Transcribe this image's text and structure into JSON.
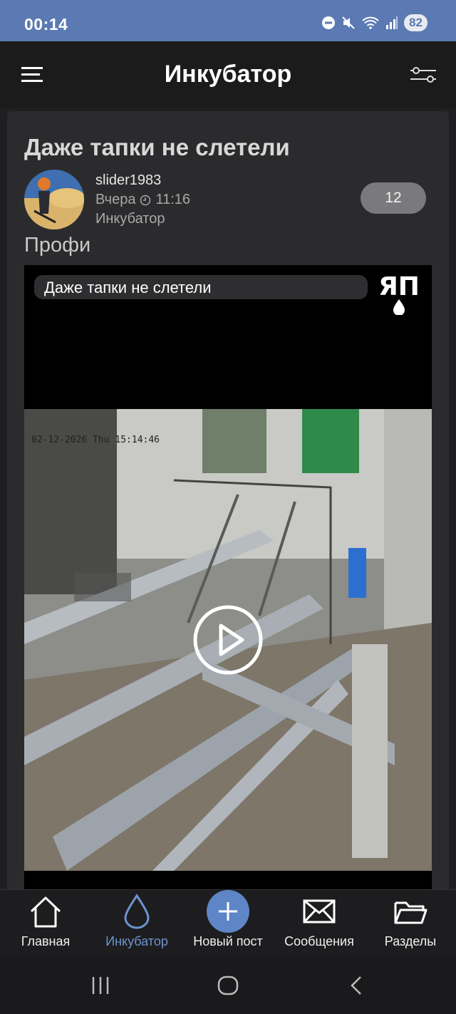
{
  "status_bar": {
    "time": "00:14",
    "battery": "82",
    "icons": [
      "dnd-icon",
      "mute-icon",
      "wifi-icon",
      "signal-icon"
    ]
  },
  "app_bar": {
    "title": "Инкубатор"
  },
  "post": {
    "title": "Даже тапки не слетели",
    "author": "slider1983",
    "date_label": "Вчера",
    "time": "11:16",
    "section": "Инкубатор",
    "comment_count": "12",
    "tag": "Профи",
    "video": {
      "caption": "Даже тапки не слетели",
      "watermark": "ЯП",
      "camera_timestamp": "02-12-2026 Thu 15:14:46"
    }
  },
  "bottom_nav": {
    "items": [
      {
        "label": "Главная",
        "icon": "home-icon"
      },
      {
        "label": "Инкубатор",
        "icon": "drop-icon",
        "active": true
      },
      {
        "label": "Новый пост",
        "icon": "plus-icon"
      },
      {
        "label": "Сообщения",
        "icon": "envelope-icon"
      },
      {
        "label": "Разделы",
        "icon": "folder-icon"
      }
    ]
  },
  "colors": {
    "status_bar": "#5b7ab3",
    "accent": "#6e93cf",
    "plus_button": "#5e86c6",
    "background": "#1f1f21",
    "card": "#2b2b2d"
  }
}
